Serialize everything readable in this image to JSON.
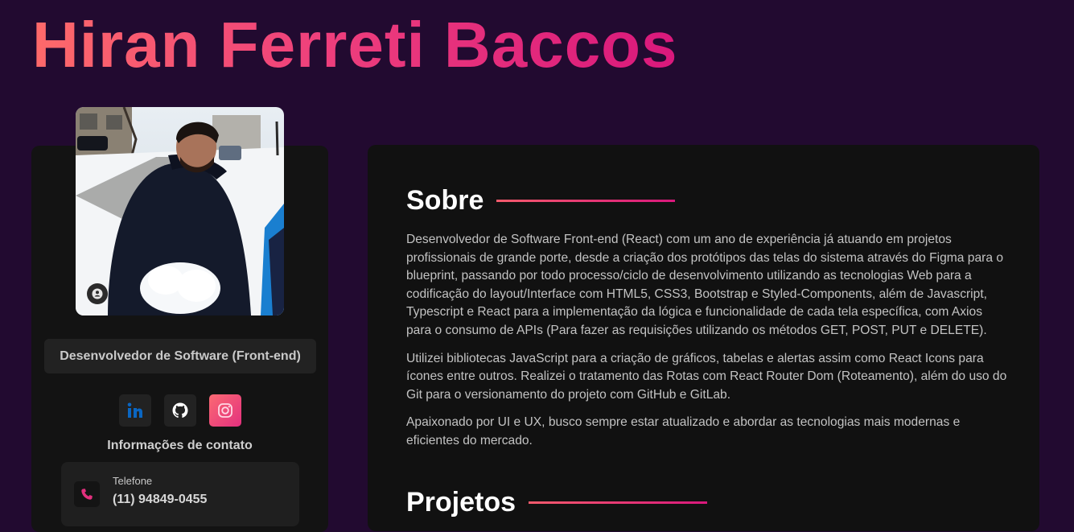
{
  "header": {
    "name": "Hiran Ferreti Baccos"
  },
  "profile": {
    "role": "Desenvolvedor de Software (Front-end)",
    "socials": [
      {
        "icon": "linkedin-icon",
        "color": "#0a66c2"
      },
      {
        "icon": "github-icon",
        "color": "#ffffff"
      },
      {
        "icon": "instagram-icon",
        "color": "#e3307e"
      }
    ],
    "contact_title": "Informações de contato",
    "contact": {
      "label": "Telefone",
      "value": "(11) 94849-0455",
      "icon": "phone-icon"
    }
  },
  "about": {
    "title": "Sobre",
    "paragraphs": [
      "Desenvolvedor de Software Front-end (React) com um ano de experiência já atuando em projetos profissionais de grande porte, desde a criação dos protótipos das telas do sistema através do Figma para o blueprint, passando por todo processo/ciclo de desenvolvimento utilizando as tecnologias Web para a codificação do layout/Interface com HTML5, CSS3, Bootstrap e Styled-Components, além de Javascript, Typescript e React para a implementação da lógica e funcionalidade de cada tela específica, com Axios para o consumo de APIs (Para fazer as requisições utilizando os métodos GET, POST, PUT e DELETE).",
      "Utilizei bibliotecas JavaScript para a criação de gráficos, tabelas e alertas assim como React Icons para ícones entre outros. Realizei o tratamento das Rotas com React Router Dom (Roteamento), além do uso do Git para o versionamento do projeto com GitHub e GitLab.",
      "Apaixonado por UI e UX, busco sempre estar atualizado e abordar as tecnologias mais modernas e eficientes do mercado."
    ]
  },
  "projects": {
    "title": "Projetos"
  },
  "colors": {
    "background": "#220a30",
    "accent_start": "#fe6a6a",
    "accent_end": "#d9187c",
    "card": "#131313"
  }
}
